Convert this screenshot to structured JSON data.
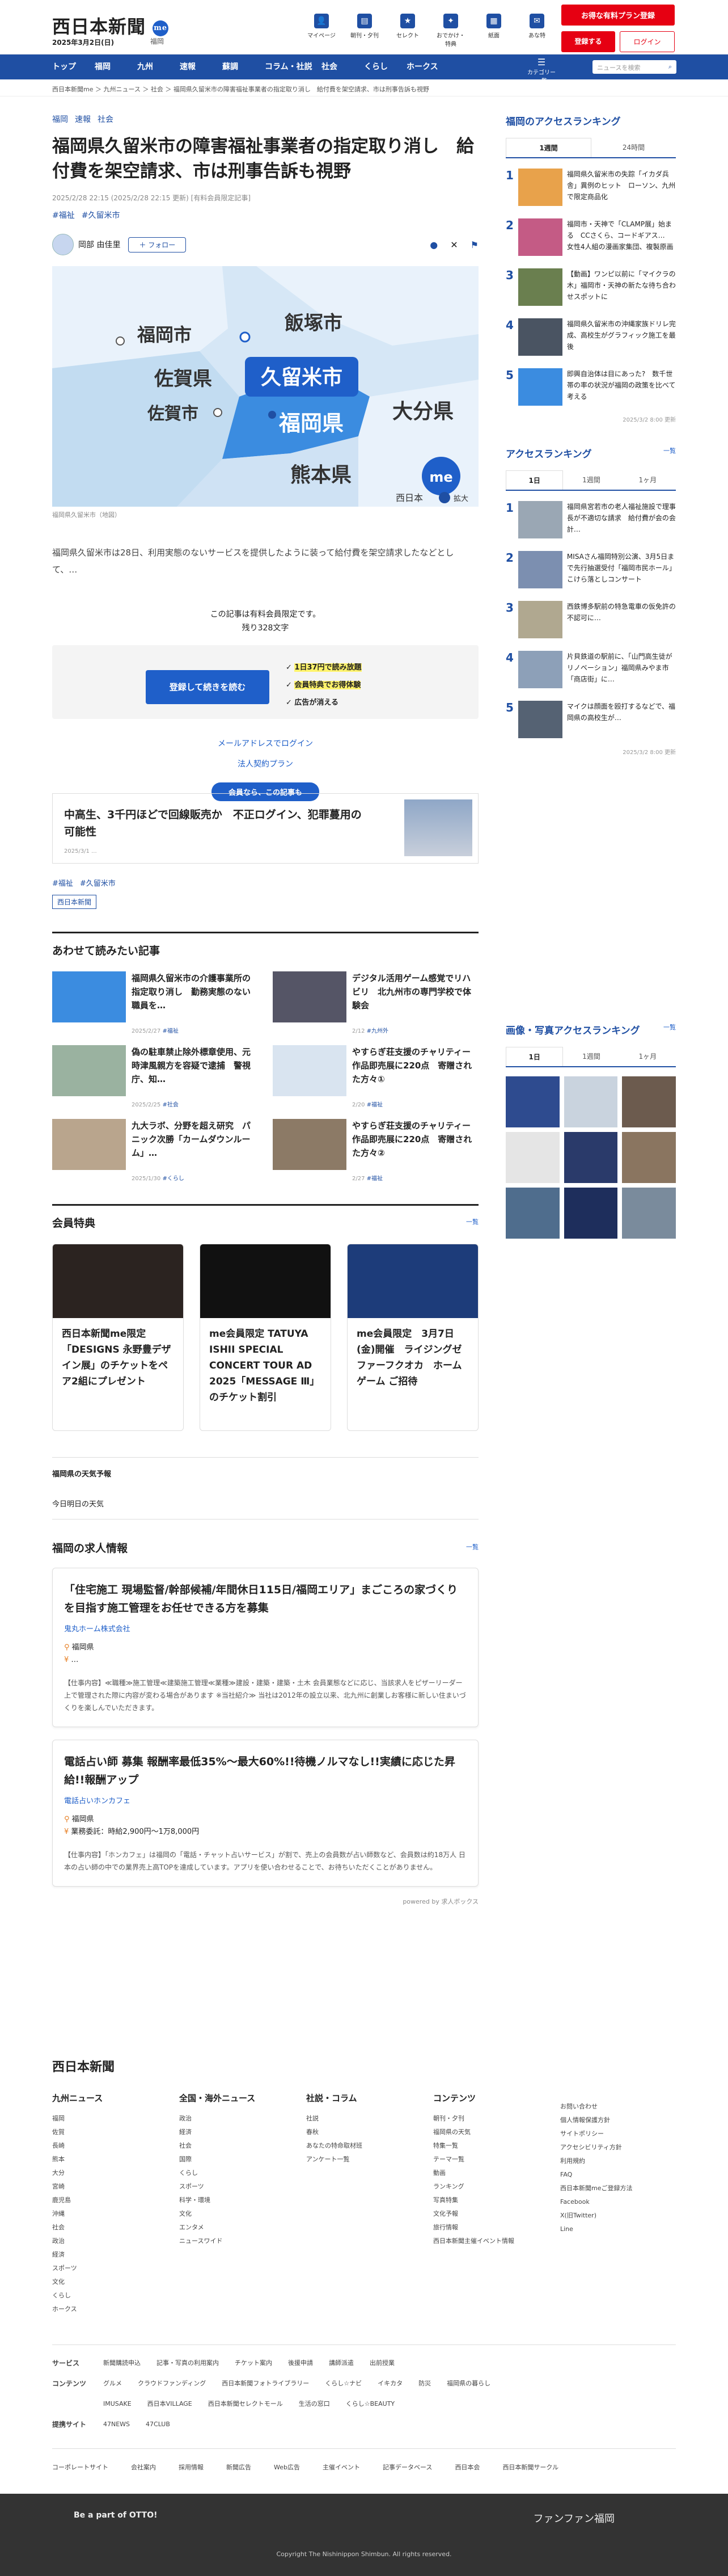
{
  "header": {
    "logo": "西日本新聞",
    "logo_badge": "me",
    "date": "2025年3月2日(日)",
    "weather": "福岡",
    "icons": [
      {
        "label": "マイページ",
        "icon": "user-icon"
      },
      {
        "label": "朝刊・夕刊",
        "icon": "newspaper-icon"
      },
      {
        "label": "セレクト",
        "icon": "bookmark-icon"
      },
      {
        "label": "おでかけ・特典",
        "icon": "ticket-icon"
      },
      {
        "label": "紙面",
        "icon": "paper-icon"
      },
      {
        "label": "あな特",
        "icon": "mail-icon"
      }
    ],
    "trial_button": "お得な有料プラン登録",
    "register_button": "登録する",
    "login_button": "ログイン"
  },
  "nav": {
    "items": [
      "トップ",
      "福岡",
      "九州",
      "速報",
      "蘇調",
      "コラム・社説",
      "社会",
      "くらし",
      "ホークス"
    ],
    "category": "カテゴリー一覧",
    "search_placeholder": "ニュースを検索"
  },
  "breadcrumb": "西日本新聞me ＞ 九州ニュース ＞ 社会 ＞ 福岡県久留米市の障害福祉事業者の指定取り消し　給付費を架空請求、市は刑事告訴も視野",
  "article": {
    "tags": [
      "福岡",
      "速報",
      "社会"
    ],
    "title": "福岡県久留米市の障害福祉事業者の指定取り消し　給付費を架空請求、市は刑事告訴も視野",
    "meta": "2025/2/28 22:15 (2025/2/28 22:15 更新) [有料会員限定記事]",
    "hashtags": [
      "#福祉",
      "#久留米市"
    ],
    "author": "岡部 由佳里",
    "follow": "＋ フォロー",
    "map_labels": {
      "iizuka": "飯塚市",
      "fukuoka": "福岡市",
      "kurume": "久留米市",
      "saga_pref": "佐賀県",
      "saga_city": "佐賀市",
      "fukuoka_pref": "福岡県",
      "oita": "大分県",
      "kumamoto": "熊本県",
      "brand": "西日本",
      "zoom": "拡大"
    },
    "caption": "福岡県久留米市（地図）",
    "lead": "福岡県久留米市は28日、利用実態のないサービスを提供したように装って給付費を架空請求したなどとして、…",
    "paywall_1": "この記事は有料会員限定です。",
    "paywall_2": "残り328文字",
    "subscribe_button": "登録して続きを読む",
    "perks": [
      "1日37円で読み放題",
      "会員特典でお得体験",
      "広告が消える"
    ],
    "login_link": "メールアドレスでログイン",
    "corp_link": "法人契約プラン",
    "promo_badge": "会員なら、この記事も",
    "promo_title": "中高生、3千円ほどで回線販売か　不正ログイン、犯罪蔓用の可能性",
    "promo_date": "2025/3/1 ...",
    "bottom_tags": [
      "#福祉",
      "#久留米市"
    ],
    "source": "西日本新聞"
  },
  "related": {
    "title": "あわせて読みたい記事",
    "items": [
      {
        "title": "福岡県久留米市の介護事業所の指定取り消し　勤務実態のない職員を…",
        "date": "2025/2/27",
        "tag": "#福祉"
      },
      {
        "title": "デジタル活用ゲーム感覚でリハビリ　北九州市の専門学校で体験会",
        "date": "2/12",
        "tag": "#九州外"
      },
      {
        "title": "偽の駐車禁止除外標章使用、元時津風親方を容疑で逮捕　警視庁、知…",
        "date": "2025/2/25",
        "tag": "#社会"
      },
      {
        "title": "やすらぎ荘支援のチャリティー作品即売展に220点　寄贈された方々①",
        "date": "2/20",
        "tag": "#福祉"
      },
      {
        "title": "九大ラボ、分野を超え研究　パニック次勝「カームダウンルーム」…",
        "date": "2025/1/30",
        "tag": "#くらし"
      },
      {
        "title": "やすらぎ荘支援のチャリティー作品即売展に220点　寄贈された方々②",
        "date": "2/27",
        "tag": "#福祉"
      }
    ]
  },
  "benefits": {
    "title": "会員特典",
    "more": "一覧",
    "items": [
      "西日本新聞me限定「DESIGNS 永野豊デザイン展」のチケットをペア2組にプレゼント",
      "me会員限定 TATUYA ISHII SPECIAL CONCERT TOUR AD 2025「MESSAGE Ⅲ」のチケット割引",
      "me会員限定　3月7日(金)開催　ライジングゼファーフクオカ　ホームゲーム ご招待"
    ]
  },
  "weather": {
    "title": "福岡県の天気予報",
    "sub": "今日明日の天気"
  },
  "jobs": {
    "title": "福岡の求人情報",
    "more": "一覧",
    "items": [
      {
        "title": "「住宅施工 現場監督/幹部候補/年間休日115日/福岡エリア」まごころの家づくりを目指す施工管理をお任せできる方を募集",
        "company": "鬼丸ホーム株式会社",
        "location": "福岡県",
        "salary": "…",
        "desc": "【仕事内容】≪職種≫施工管理≪建築施工管理≪業種≫建設・建築・建築・土木 会員業態などに応じ、当該求人をピザーリーダー上で管理された際に内容が変わる場合があります ※当社紹介≫ 当社は2012年の設立以来、北九州に創業しお客様に新しい住まいづくりを楽しんでいただきます。"
      },
      {
        "title": "電話占い師 募集 報酬率最低35%〜最大60%!!待機ノルマなし!!実績に応じた昇給!!報酬アップ",
        "company": "電話占いホンカフェ",
        "location": "福岡県",
        "salary": "業務委託：時給2,900円〜1万8,000円",
        "desc": "【仕事内容】「ホンカフェ」は福岡の「電話・チャット占いサービス」が割で、売上の会員数が占い師数など、会員数は約18万人 日本の占い師の中での業界売上高TOPを達成しています。アプリを使い合わせることで、お待ちいただくことがありません。"
      }
    ],
    "sponsor": "powered by 求人ボックス"
  },
  "ranking": {
    "title": "福岡のアクセスランキング",
    "tabs": [
      "1週間",
      "24時間"
    ],
    "items": [
      "福岡県久留米市の失踪「イカダ兵舎」異例のヒット　ローソン、九州で限定商品化",
      "福岡市・天神で「CLAMP展」始まる　CCさくら、コードギアス…　女性4人組の漫画家集団、複製原画550点以上展示",
      "【動画】ワンピ以前に「マイクラの木」福岡市・天神の新たな待ち合わせスポットに",
      "福岡県久留米市の沖縄家族ドリレ完成、高校生がグラフィック施工を最後",
      "即興自治体は目にあった?　数千世帯の率の状況が福岡の政策を比べて考える"
    ],
    "time": "2025/3/2 8:00 更新"
  },
  "ranking2": {
    "title": "アクセスランキング",
    "more": "一覧",
    "tabs": [
      "1日",
      "1週間",
      "1ヶ月"
    ],
    "items": [
      "福岡県宮若市の老人福祉施設で理事長が不適切な請求　給付費が会の会計…",
      "MISAさん福岡特別公演、3月5日まで先行抽選受付「福岡市民ホール」こけら落としコンサート",
      "西鉄博多駅前の特急電車の仮免許の不認可に…",
      "片貝鉄道の駅前に、「山門高生徒がリノベーション」福岡県みやま市「商店街」に…",
      "マイクは顔面を殴打するなどで、福岡県の高校生が…"
    ],
    "time": "2025/3/2 8:00 更新"
  },
  "photo_ranking": {
    "title": "画像・写真アクセスランキング",
    "more": "一覧",
    "tabs": [
      "1日",
      "1週間",
      "1ヶ月"
    ]
  },
  "footer": {
    "brand": "西日本新聞",
    "cols": [
      {
        "h": "九州ニュース",
        "items": [
          "福岡",
          "佐賀",
          "長崎",
          "熊本",
          "大分",
          "宮崎",
          "鹿児島",
          "沖縄",
          "社会",
          "政治",
          "経済",
          "スポーツ",
          "文化",
          "くらし",
          "ホークス"
        ]
      },
      {
        "h": "全国・海外ニュース",
        "items": [
          "政治",
          "経済",
          "社会",
          "国際",
          "くらし",
          "スポーツ",
          "科学・環境",
          "文化",
          "エンタメ",
          "ニュースワイド"
        ]
      },
      {
        "h": "社説・コラム",
        "items": [
          "社説",
          "春秋",
          "あなたの特命取材班",
          "アンケート一覧"
        ]
      },
      {
        "h": "コンテンツ",
        "items": [
          "朝刊・夕刊",
          "福岡県の天気",
          "特集一覧",
          "テーマ一覧",
          "動画",
          "ランキング",
          "写真特集",
          "文化予報",
          "旅行情報",
          "西日本新聞主催イベント情報"
        ]
      },
      {
        "h": "",
        "items": [
          "お問い合わせ",
          "個人情報保護方針",
          "サイトポリシー",
          "アクセシビリティ方針",
          "利用規約",
          "FAQ",
          "西日本新聞meご登録方法",
          "Facebook",
          "X(旧Twitter)",
          "Line"
        ]
      }
    ],
    "rows": [
      {
        "h": "サービス",
        "items": [
          "新聞購読申込",
          "記事・写真の利用案内",
          "チケット案内",
          "後援申請",
          "講師派遣",
          "出前授業"
        ]
      },
      {
        "h": "コンテンツ",
        "items": [
          "グルメ",
          "クラウドファンディング",
          "西日本新聞フォトライブラリー",
          "くらし☆ナビ",
          "イキカタ",
          "防災",
          "福岡県の暮らし"
        ]
      },
      {
        "h": "",
        "items": [
          "IMUSAKE",
          "西日本VILLAGE",
          "西日本新聞セレクトモール",
          "生活の窓口",
          "くらし☆BEAUTY"
        ]
      },
      {
        "h": "提携サイト",
        "items": [
          "47NEWS",
          "47CLUB"
        ]
      }
    ],
    "bottom": [
      "コーポレートサイト",
      "会社案内",
      "採用情報",
      "新聞広告",
      "Web広告",
      "主催イベント",
      "記事データベース",
      "西日本会",
      "西日本新聞サークル"
    ],
    "copyright": "Copyright The Nishinippon Shimbun. All rights reserved.",
    "otto": "Be a part of OTTO!",
    "fanfan": "ファンファン福岡"
  }
}
